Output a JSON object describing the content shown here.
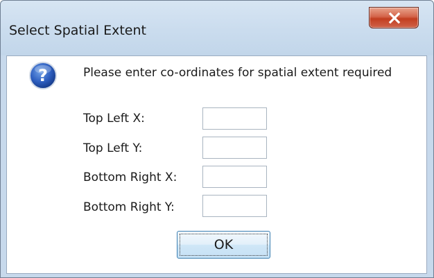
{
  "window": {
    "title": "Select Spatial Extent",
    "close_icon": "close-x-icon"
  },
  "dialog": {
    "icon": "question-icon",
    "message": "Please enter co-ordinates for spatial extent required",
    "fields": [
      {
        "label": "Top Left X:",
        "value": ""
      },
      {
        "label": "Top Left Y:",
        "value": ""
      },
      {
        "label": "Bottom Right X:",
        "value": ""
      },
      {
        "label": "Bottom Right Y:",
        "value": ""
      }
    ],
    "ok_label": "OK"
  },
  "colors": {
    "titlebar": "#c7d9ec",
    "close_button": "#c9482c",
    "icon_blue": "#1f4fa8",
    "ok_button_border": "#3c7fb1"
  }
}
